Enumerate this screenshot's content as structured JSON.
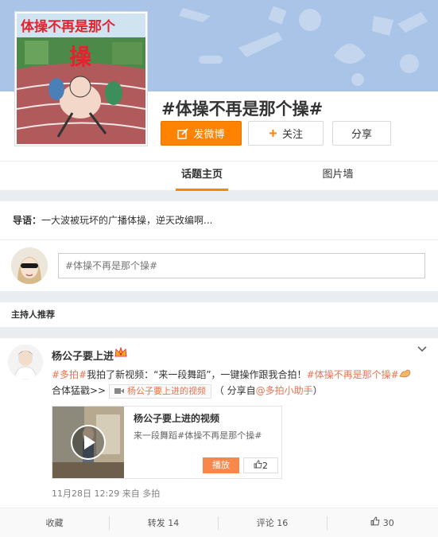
{
  "topic": {
    "title": "#体操不再是那个操#",
    "cover_caption": "体操不再是那个",
    "cover_logo": "操"
  },
  "buttons": {
    "post": "发微博",
    "follow": "关注",
    "share": "分享"
  },
  "tabs": [
    {
      "label": "话题主页",
      "active": true
    },
    {
      "label": "图片墙",
      "active": false
    }
  ],
  "intro": {
    "label": "导语：",
    "text": "一大波被玩坏的广播体操，逆天改编啊..."
  },
  "composer": {
    "placeholder": "#体操不再是那个操#"
  },
  "section_title": "主持人推荐",
  "post": {
    "user": "杨公子要上进",
    "text": {
      "tag1": "#多拍#",
      "part1": "我拍了新视频：“来一段舞蹈”，一键操作跟我合拍！",
      "tag2": "#体操不再是那个操#",
      "part2": "合体猛戳>>",
      "video_tag": "杨公子要上进的视频",
      "part3": "（ 分享自",
      "mention": "@多拍小助手",
      "part4": "）"
    },
    "card": {
      "title": "杨公子要上进的视频",
      "desc": "来一段舞蹈#体操不再是那个操#",
      "play": "播放",
      "likes": "2"
    },
    "meta": {
      "time": "11月28日 12:29",
      "from_label": "来自",
      "source": "多拍"
    },
    "actions": {
      "favorite": "收藏",
      "forward": "转发 14",
      "comment": "评论 16",
      "like": "30"
    }
  },
  "colors": {
    "accent": "#ff8200",
    "link": "#eb7350",
    "banner": "#a9c4e6"
  }
}
